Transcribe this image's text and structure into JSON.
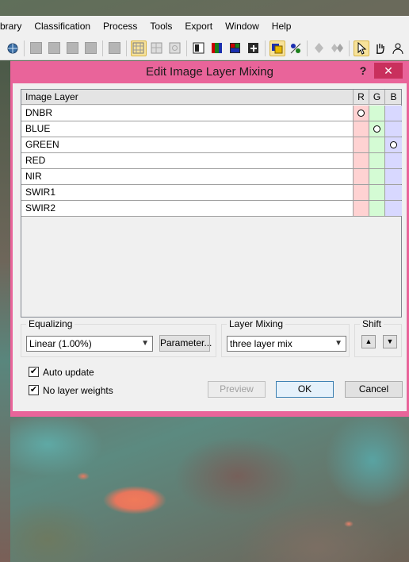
{
  "menubar": {
    "items": [
      "brary",
      "Classification",
      "Process",
      "Tools",
      "Export",
      "Window",
      "Help"
    ]
  },
  "toolbar": {
    "icons": [
      "globe-icon",
      "layer-a-icon",
      "layer-b-icon",
      "layer-c-icon",
      "layer-d-icon",
      "layer-e-icon",
      "grid-active-icon",
      "grid-icon",
      "grid-b-icon",
      "view-single-icon",
      "view-rgb-icon",
      "view-split-icon",
      "view-add-icon",
      "layers-active-icon",
      "shuffle-icon",
      "diamond-icon",
      "diamonds-icon",
      "pointer-active-icon",
      "hand-icon",
      "user-edit-icon"
    ]
  },
  "dialog": {
    "title": "Edit Image Layer Mixing",
    "help_label": "?",
    "close_label": "✕",
    "table": {
      "headers": {
        "name": "Image Layer",
        "r": "R",
        "g": "G",
        "b": "B"
      },
      "rows": [
        {
          "name": "DNBR",
          "selected": "r"
        },
        {
          "name": "BLUE",
          "selected": "g"
        },
        {
          "name": "GREEN",
          "selected": "b"
        },
        {
          "name": "RED",
          "selected": ""
        },
        {
          "name": "NIR",
          "selected": ""
        },
        {
          "name": "SWIR1",
          "selected": ""
        },
        {
          "name": "SWIR2",
          "selected": ""
        }
      ]
    },
    "equalizing": {
      "label": "Equalizing",
      "value": "Linear (1.00%)",
      "parameter_label": "Parameter..."
    },
    "layer_mixing": {
      "label": "Layer Mixing",
      "value": "three layer mix"
    },
    "shift": {
      "label": "Shift",
      "up": "▲",
      "down": "▼"
    },
    "auto_update": {
      "label": "Auto update",
      "checked": true
    },
    "no_layer_weights": {
      "label": "No layer weights",
      "checked": true
    },
    "buttons": {
      "preview": "Preview",
      "ok": "OK",
      "cancel": "Cancel"
    },
    "colors": {
      "title_bar": "#e9649a",
      "close": "#c9305d",
      "r": "#ffd2d2",
      "g": "#d4fbd4",
      "b": "#d8d8ff"
    }
  }
}
